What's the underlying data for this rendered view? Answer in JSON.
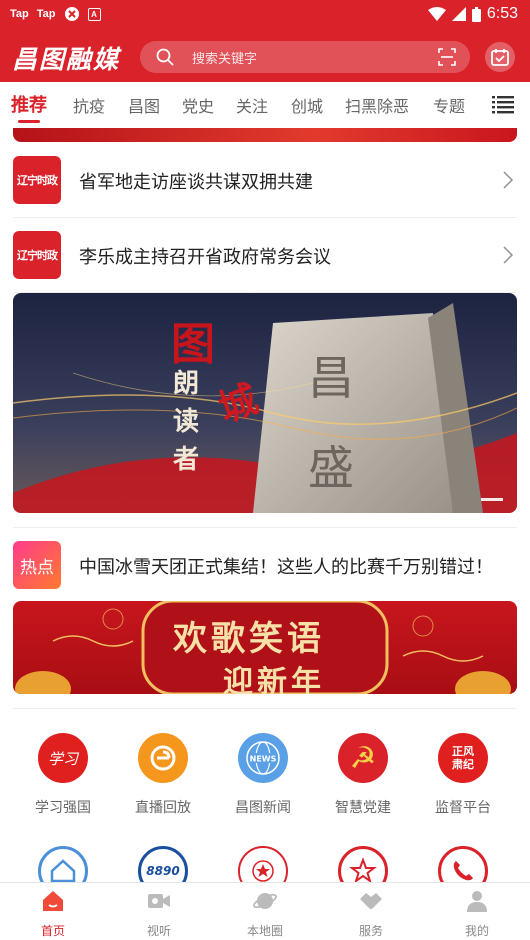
{
  "status_bar": {
    "left_items": [
      "Tap",
      "Tap"
    ],
    "time": "6:53"
  },
  "header": {
    "logo": "昌图融媒",
    "search_placeholder": "搜索关键字"
  },
  "tabs": [
    {
      "label": "推荐",
      "active": true
    },
    {
      "label": "抗疫"
    },
    {
      "label": "昌图"
    },
    {
      "label": "党史"
    },
    {
      "label": "关注"
    },
    {
      "label": "创城"
    },
    {
      "label": "扫黑除恶"
    },
    {
      "label": "专题"
    }
  ],
  "news": [
    {
      "source_badge": "辽宁时政",
      "title": "省军地走访座谈共谋双拥共建"
    },
    {
      "source_badge": "辽宁时政",
      "title": "李乐成主持召开省政府常务会议"
    }
  ],
  "hero": {
    "text_left": "图",
    "text_vertical": "朗读者",
    "text_city": "城",
    "text_tablet": "昌盛"
  },
  "hot": {
    "badge": "热点",
    "title": "中国冰雪天团正式集结！这些人的比赛千万别错过！"
  },
  "banner2": {
    "line1": "欢歌笑语",
    "line2": "迎新年"
  },
  "services_row1": [
    {
      "label": "学习强国",
      "icon": "xuexi-icon",
      "color": "#e0201f",
      "glyph": "学习"
    },
    {
      "label": "直播回放",
      "icon": "live-replay-icon",
      "color": "#f5961d",
      "glyph": "e"
    },
    {
      "label": "昌图新闻",
      "icon": "news-globe-icon",
      "color": "#5aa0e6",
      "glyph": "NEWS"
    },
    {
      "label": "智慧党建",
      "icon": "party-emblem-icon",
      "color": "#d9222a",
      "glyph": "☭"
    },
    {
      "label": "监督平台",
      "icon": "supervision-icon",
      "color": "#e0201f",
      "glyph": "正风肃纪"
    }
  ],
  "services_row2": [
    {
      "icon": "home-service-icon",
      "color": "#4a8fd9"
    },
    {
      "icon": "hotline-8890-icon",
      "color": "#1a4fa0",
      "glyph": "8890"
    },
    {
      "icon": "police-badge-icon",
      "color": "#d9222a"
    },
    {
      "icon": "star-emblem-icon",
      "color": "#d9222a"
    },
    {
      "icon": "phone-service-icon",
      "color": "#d9222a"
    }
  ],
  "bottom_nav": [
    {
      "label": "首页",
      "icon": "home-icon",
      "active": true
    },
    {
      "label": "视听",
      "icon": "video-icon"
    },
    {
      "label": "本地圈",
      "icon": "planet-icon"
    },
    {
      "label": "服务",
      "icon": "handshake-icon"
    },
    {
      "label": "我的",
      "icon": "user-icon"
    }
  ],
  "colors": {
    "brand": "#d9222a",
    "tab_inactive": "#666666",
    "nav_inactive": "#888888"
  }
}
